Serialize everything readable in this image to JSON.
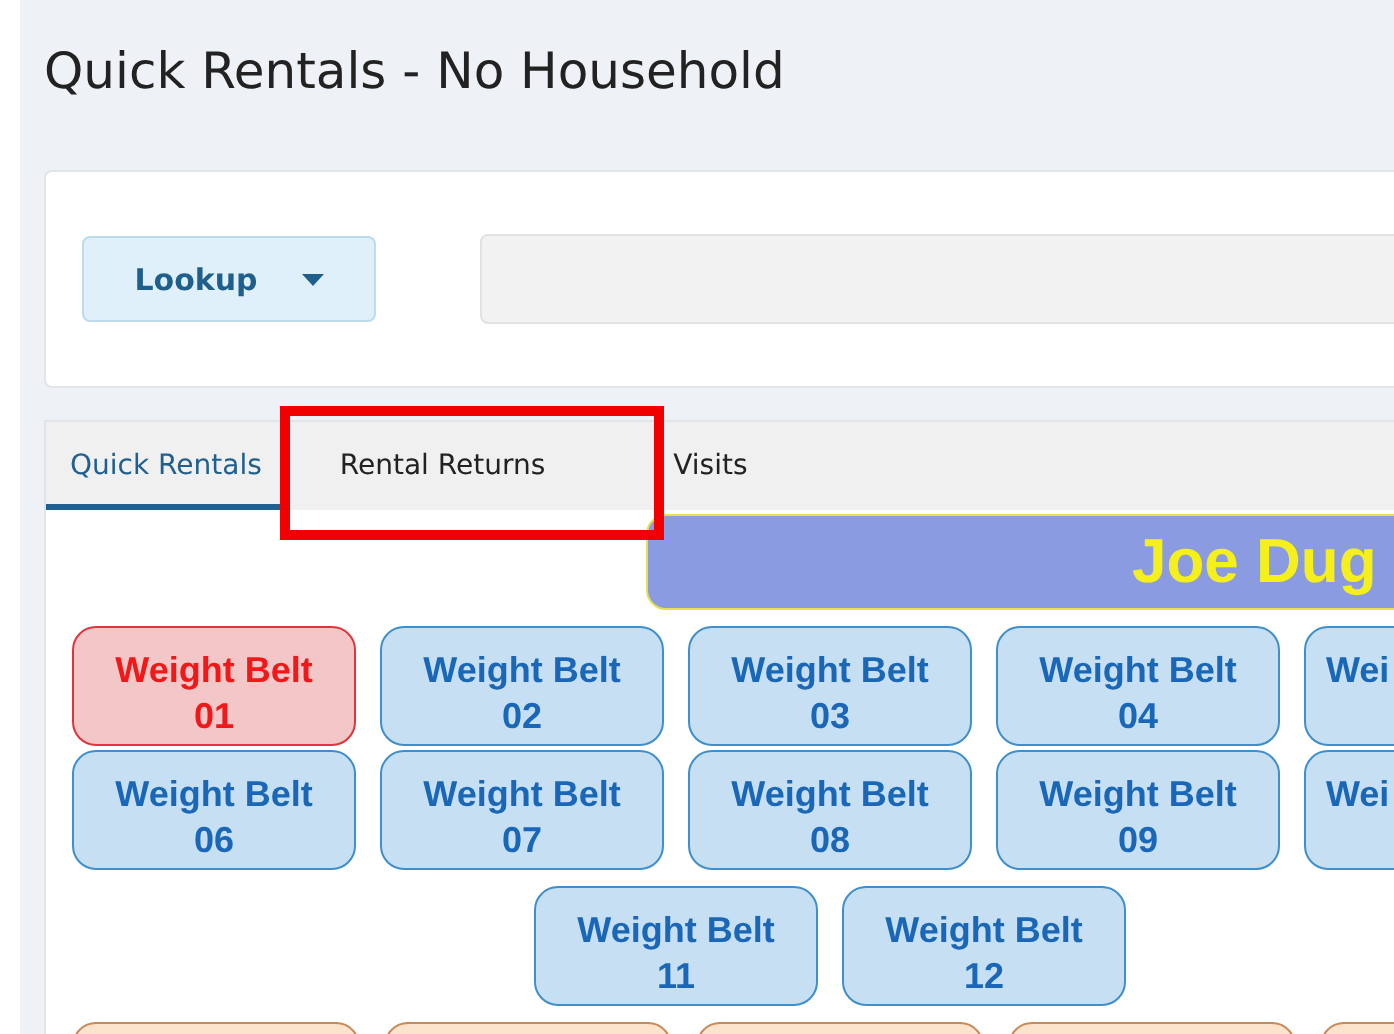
{
  "title": "Quick Rentals - No Household",
  "lookup": {
    "label": "Lookup"
  },
  "tabs": [
    {
      "label": "Quick Rentals",
      "selected": true
    },
    {
      "label": "Rental Returns",
      "selected": false
    },
    {
      "label": "Visits",
      "selected": false
    }
  ],
  "customer": {
    "name": "Joe Dug"
  },
  "rows": [
    {
      "items": [
        {
          "kind": "item",
          "label": "Weight Belt",
          "number": "01",
          "selected": true
        },
        {
          "kind": "item",
          "label": "Weight Belt",
          "number": "02",
          "selected": false
        },
        {
          "kind": "item",
          "label": "Weight Belt",
          "number": "03",
          "selected": false
        },
        {
          "kind": "item",
          "label": "Weight Belt",
          "number": "04",
          "selected": false
        },
        {
          "kind": "cut",
          "label": "Wei",
          "selected": false
        }
      ]
    },
    {
      "items": [
        {
          "kind": "item",
          "label": "Weight Belt",
          "number": "06",
          "selected": false
        },
        {
          "kind": "item",
          "label": "Weight Belt",
          "number": "07",
          "selected": false
        },
        {
          "kind": "item",
          "label": "Weight Belt",
          "number": "08",
          "selected": false
        },
        {
          "kind": "item",
          "label": "Weight Belt",
          "number": "09",
          "selected": false
        },
        {
          "kind": "cut",
          "label": "Wei",
          "selected": false
        }
      ]
    },
    {
      "items": [
        {
          "kind": "item",
          "label": "Weight Belt",
          "number": "11",
          "selected": false
        },
        {
          "kind": "item",
          "label": "Weight Belt",
          "number": "12",
          "selected": false
        }
      ]
    },
    {
      "items": [
        {
          "kind": "stub"
        },
        {
          "kind": "stub"
        },
        {
          "kind": "stub"
        },
        {
          "kind": "stub"
        },
        {
          "kind": "stub"
        }
      ]
    }
  ]
}
